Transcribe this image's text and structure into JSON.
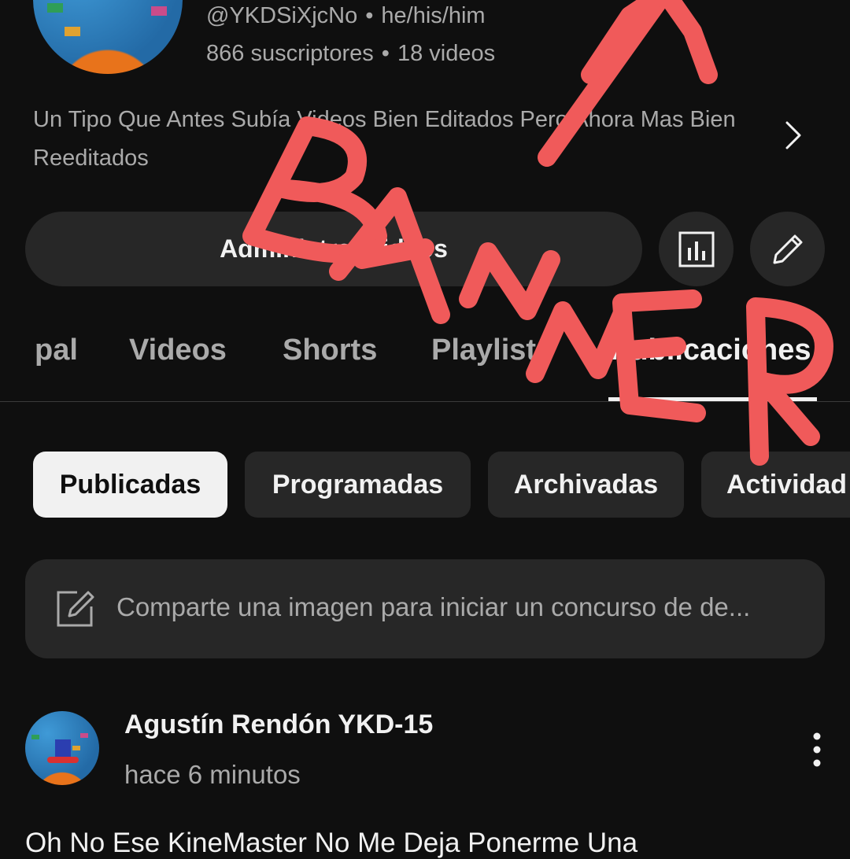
{
  "channel": {
    "handle": "@YKDSiXjcNo",
    "pronouns": "he/his/him",
    "subscribers": "866 suscriptores",
    "video_count": "18 videos",
    "description": "Un Tipo Que Antes Subía Videos Bien Editados Pero Ahora Mas Bien Reeditados"
  },
  "actions": {
    "manage_label": "Administrar videos",
    "analytics_icon": "analytics-icon",
    "edit_icon": "pencil-icon"
  },
  "tabs": [
    {
      "label": "pal"
    },
    {
      "label": "Videos"
    },
    {
      "label": "Shorts"
    },
    {
      "label": "Playlists"
    },
    {
      "label": "Publicaciones",
      "active": true
    }
  ],
  "chips": [
    {
      "label": "Publicadas",
      "selected": true
    },
    {
      "label": "Programadas"
    },
    {
      "label": "Archivadas"
    },
    {
      "label": "Actividad"
    }
  ],
  "compose": {
    "placeholder": "Comparte una imagen para iniciar un concurso de de..."
  },
  "post": {
    "author": "Agustín Rendón YKD-15",
    "time": "hace 6 minutos",
    "body": "Oh No Ese KineMaster No Me Deja Ponerme Una"
  },
  "annotation": {
    "text": "BANNER",
    "color": "#f05a5a"
  }
}
